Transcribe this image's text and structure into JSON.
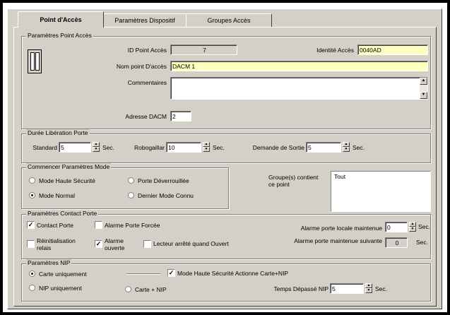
{
  "tabs": [
    "Point d'Accès",
    "Paramètres Dispositif",
    "Groupes Accès"
  ],
  "g_point": {
    "legend": "Paramètres Point Accès",
    "id_label": "ID Point Accès",
    "id_value": "7",
    "identite_label": "Identité Accès",
    "identite_value": "0040AD",
    "nom_label": "Nom point D'accès",
    "nom_value": "DACM 1",
    "comment_label": "Commentaires",
    "comment_value": "",
    "adresse_label": "Adresse DACM",
    "adresse_value": "2"
  },
  "g_duree": {
    "legend": "Durée Libération Porte",
    "standard_label": "Standard",
    "standard_value": "5",
    "sec1": "Sec.",
    "robot_label": "Robogaillar",
    "robot_value": "10",
    "sec2": "Sec.",
    "sortie_label": "Demande de Sortie",
    "sortie_value": "5",
    "sec3": "Sec."
  },
  "g_mode": {
    "legend": "Commencer Paramètres Mode",
    "opt1": "Mode Haute Sécurité",
    "opt2": "Porte Déverrouillée",
    "opt3": "Mode Normal",
    "opt4": "Dernier Mode Connu"
  },
  "groupes": {
    "label": "Groupe(s) contient ce point",
    "items": [
      "Tout"
    ]
  },
  "g_contact": {
    "legend": "Paramètres Contact Porte",
    "contact": "Contact Porte",
    "alarme_forcee": "Alarme Porte Forcée",
    "reinit": "Réinitialisation relais",
    "alarme_ouverte": "Alarme ouverte",
    "lecteur": "Lecteur arrêté quand Ouvert",
    "locale_label": "Alarme porte locale maintenue",
    "locale_value": "0",
    "sec": "Sec.",
    "suivante_label": "Alarme porte maintenue suivante",
    "suivante_value": "0",
    "sec_b": "Sec."
  },
  "g_nip": {
    "legend": "Paramètres NIP",
    "carte": "Carte uniquement",
    "nip": "NIP uniquement",
    "carte_nip": "Carte + NIP",
    "haute": "Mode Haute Sécurité Actionne Carte+NIP",
    "temps_label": "Temps Dépassé NIP",
    "temps_value": "5",
    "sec": "Sec."
  }
}
